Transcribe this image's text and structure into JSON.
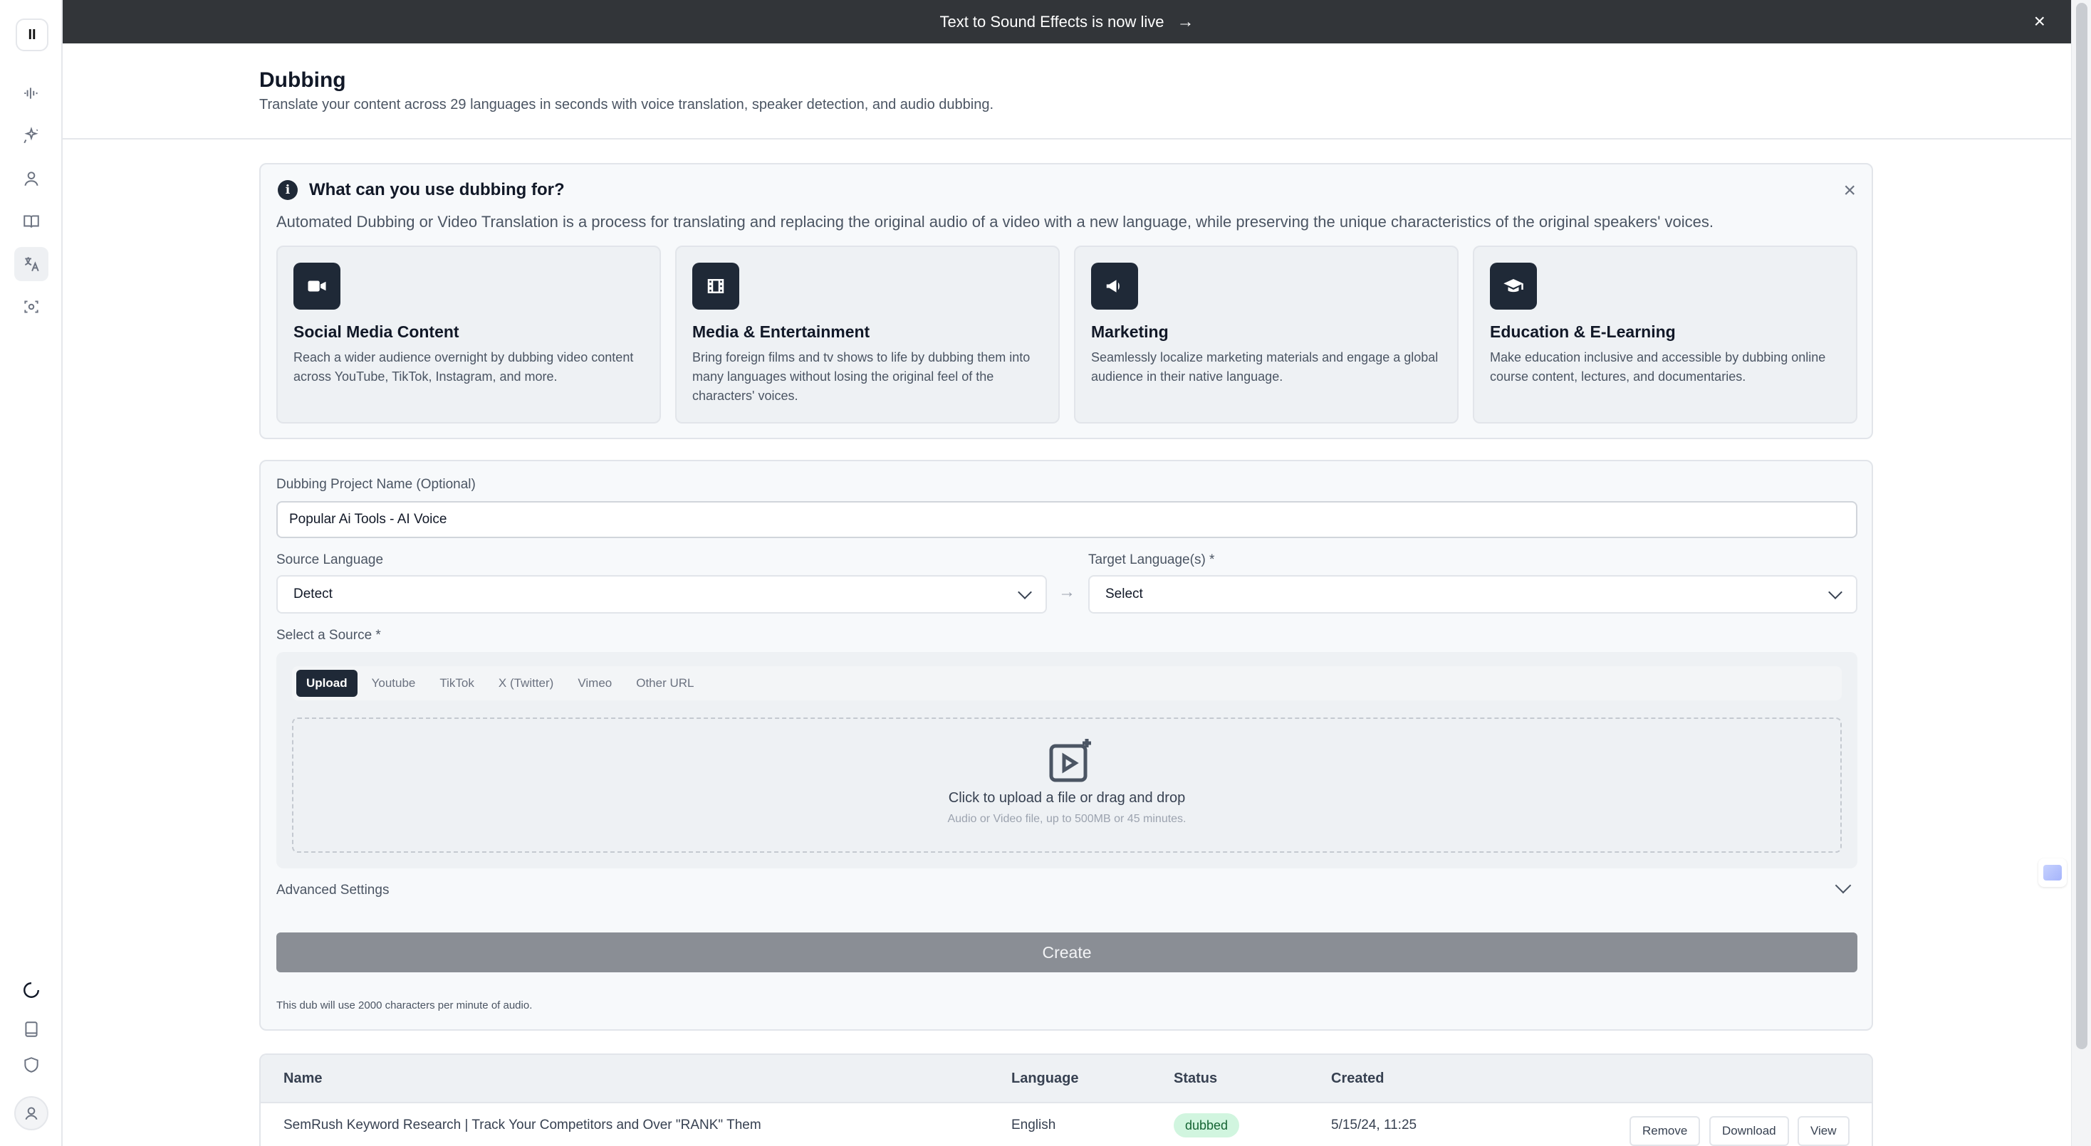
{
  "banner": {
    "text": "Text to Sound Effects is now live",
    "arrow": "→",
    "close": "×"
  },
  "sidebar": {
    "logo": "II",
    "icons": [
      "waveform-icon",
      "sparkle-icon",
      "voices-icon",
      "book-icon",
      "dubbing-icon",
      "voice-isolator-icon"
    ],
    "bottom_icons": [
      "loading-icon",
      "document-icon",
      "shield-icon",
      "user-icon"
    ]
  },
  "header": {
    "title": "Dubbing",
    "subtitle": "Translate your content across 29 languages in seconds with voice translation, speaker detection, and audio dubbing."
  },
  "info": {
    "icon": "i",
    "title": "What can you use dubbing for?",
    "description": "Automated Dubbing or Video Translation is a process for translating and replacing the original audio of a video with a new language, while preserving the unique characteristics of the original speakers' voices.",
    "close": "×",
    "cards": [
      {
        "icon": "video-camera-icon",
        "title": "Social Media Content",
        "text": "Reach a wider audience overnight by dubbing video content across YouTube, TikTok, Instagram, and more."
      },
      {
        "icon": "film-icon",
        "title": "Media & Entertainment",
        "text": "Bring foreign films and tv shows to life by dubbing them into many languages without losing the original feel of the characters' voices."
      },
      {
        "icon": "megaphone-icon",
        "title": "Marketing",
        "text": "Seamlessly localize marketing materials and engage a global audience in their native language."
      },
      {
        "icon": "graduation-cap-icon",
        "title": "Education & E-Learning",
        "text": "Make education inclusive and accessible by dubbing online course content, lectures, and documentaries."
      }
    ]
  },
  "form": {
    "project_label": "Dubbing Project Name (Optional)",
    "project_value": "Popular Ai Tools - AI Voice",
    "source_label": "Source Language",
    "source_value": "Detect",
    "target_label": "Target Language(s) *",
    "target_value": "Select",
    "lang_arrow": "→",
    "select_source_label": "Select a Source *",
    "tabs": [
      "Upload",
      "Youtube",
      "TikTok",
      "X (Twitter)",
      "Vimeo",
      "Other URL"
    ],
    "upload_title": "Click to upload a file or drag and drop",
    "upload_sub": "Audio or Video file, up to 500MB or 45 minutes.",
    "advanced_label": "Advanced Settings",
    "create_label": "Create",
    "note": "This dub will use 2000 characters per minute of audio."
  },
  "table": {
    "headers": [
      "Name",
      "Language",
      "Status",
      "Created"
    ],
    "rows": [
      {
        "name": "SemRush Keyword Research | Track Your Competitors and Over \"RANK\" Them",
        "language": "English",
        "status": "dubbed",
        "created": "5/15/24, 11:25",
        "actions": [
          "Remove",
          "Download",
          "View"
        ]
      }
    ]
  },
  "colors": {
    "banner_bg": "#323539",
    "accent_dark": "#1f2937",
    "status_dubbed_bg": "#d1f5df",
    "status_dubbed_text": "#166534",
    "create_disabled": "#8a8e95"
  }
}
